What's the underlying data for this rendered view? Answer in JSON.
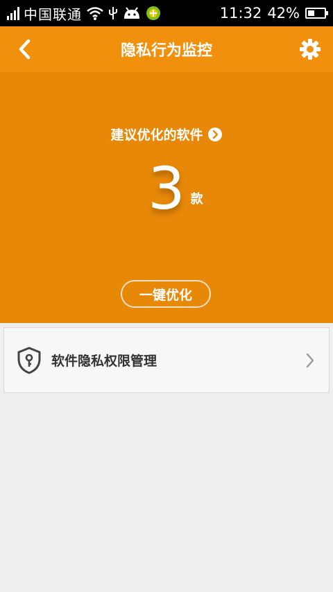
{
  "status_bar": {
    "carrier": "中国联通",
    "time": "11:32",
    "battery_percent": "42%",
    "battery_level": 0.42,
    "icons": [
      "signal-icon",
      "wifi-icon",
      "usb-icon",
      "android-icon",
      "app-notification-icon",
      "battery-icon"
    ]
  },
  "header": {
    "title": "隐私行为监控",
    "back_icon": "back-icon",
    "settings_icon": "gear-icon"
  },
  "hero": {
    "suggest_label": "建议优化的软件",
    "count": "3",
    "unit": "款",
    "optimize_button": "一键优化",
    "background_color": "#e88808"
  },
  "list": {
    "items": [
      {
        "label": "软件隐私权限管理",
        "icon": "shield-key-icon"
      }
    ]
  },
  "colors": {
    "accent": "#f0900d",
    "hero": "#e88808",
    "page_bg": "#efefef"
  }
}
